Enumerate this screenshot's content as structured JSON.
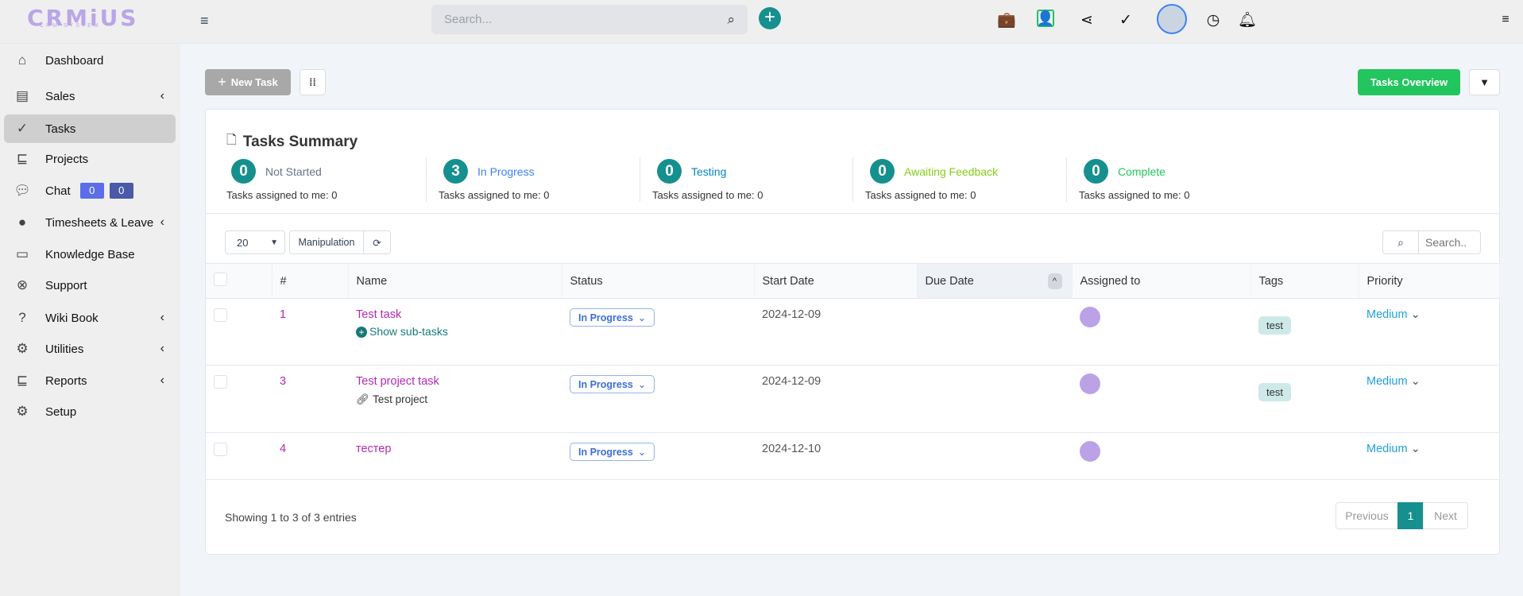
{
  "brand": {
    "name": "CRMiUS",
    "tagline": "CRM SYSTEM"
  },
  "header": {
    "search_placeholder": "Search..."
  },
  "sidebar": {
    "items": [
      {
        "label": "Dashboard",
        "icon": "home-icon"
      },
      {
        "label": "Sales",
        "icon": "receipt-icon",
        "submenu": true
      },
      {
        "label": "Tasks",
        "icon": "check-circle-icon",
        "active": true
      },
      {
        "label": "Projects",
        "icon": "chart-bars-icon"
      },
      {
        "label": "Chat",
        "icon": "chat-icon",
        "badges": [
          "0",
          "0"
        ]
      },
      {
        "label": "Timesheets & Leave",
        "icon": "user-circle-icon",
        "submenu": true
      },
      {
        "label": "Knowledge Base",
        "icon": "folder-icon"
      },
      {
        "label": "Support",
        "icon": "lifebuoy-icon"
      },
      {
        "label": "Wiki Book",
        "icon": "question-icon",
        "submenu": true
      },
      {
        "label": "Utilities",
        "icon": "cogs-icon",
        "submenu": true
      },
      {
        "label": "Reports",
        "icon": "reports-icon",
        "submenu": true
      },
      {
        "label": "Setup",
        "icon": "gear-icon"
      }
    ]
  },
  "toolbar": {
    "new_task": "New Task",
    "tasks_overview": "Tasks Overview"
  },
  "summary": {
    "title": "Tasks Summary",
    "stats": [
      {
        "count": "0",
        "label": "Not Started",
        "assigned": "Tasks assigned to me: 0",
        "color": "#64748b"
      },
      {
        "count": "3",
        "label": "In Progress",
        "assigned": "Tasks assigned to me: 0",
        "color": "#3b82f6"
      },
      {
        "count": "0",
        "label": "Testing",
        "assigned": "Tasks assigned to me: 0",
        "color": "#0284c7"
      },
      {
        "count": "0",
        "label": "Awaiting Feedback",
        "assigned": "Tasks assigned to me: 0",
        "color": "#84cc16"
      },
      {
        "count": "0",
        "label": "Complete",
        "assigned": "Tasks assigned to me: 0",
        "color": "#22c55e"
      }
    ]
  },
  "table": {
    "page_size": "20",
    "manipulation": "Manipulation",
    "search_placeholder": "Search..",
    "columns": [
      "#",
      "Name",
      "Status",
      "Start Date",
      "Due Date",
      "Assigned to",
      "Tags",
      "Priority"
    ],
    "rows": [
      {
        "id": "1",
        "name": "Test task",
        "extra": "Show sub-tasks",
        "status": "In Progress",
        "start": "2024-12-09",
        "due": "",
        "tag": "test",
        "priority": "Medium"
      },
      {
        "id": "3",
        "name": "Test project task",
        "extra": "Test project",
        "status": "In Progress",
        "start": "2024-12-09",
        "due": "",
        "tag": "test",
        "priority": "Medium"
      },
      {
        "id": "4",
        "name": "тестер",
        "extra": "",
        "status": "In Progress",
        "start": "2024-12-10",
        "due": "",
        "tag": "",
        "priority": "Medium"
      }
    ],
    "footer": "Showing 1 to 3 of 3 entries",
    "pagination": {
      "previous": "Previous",
      "current": "1",
      "next": "Next"
    }
  }
}
